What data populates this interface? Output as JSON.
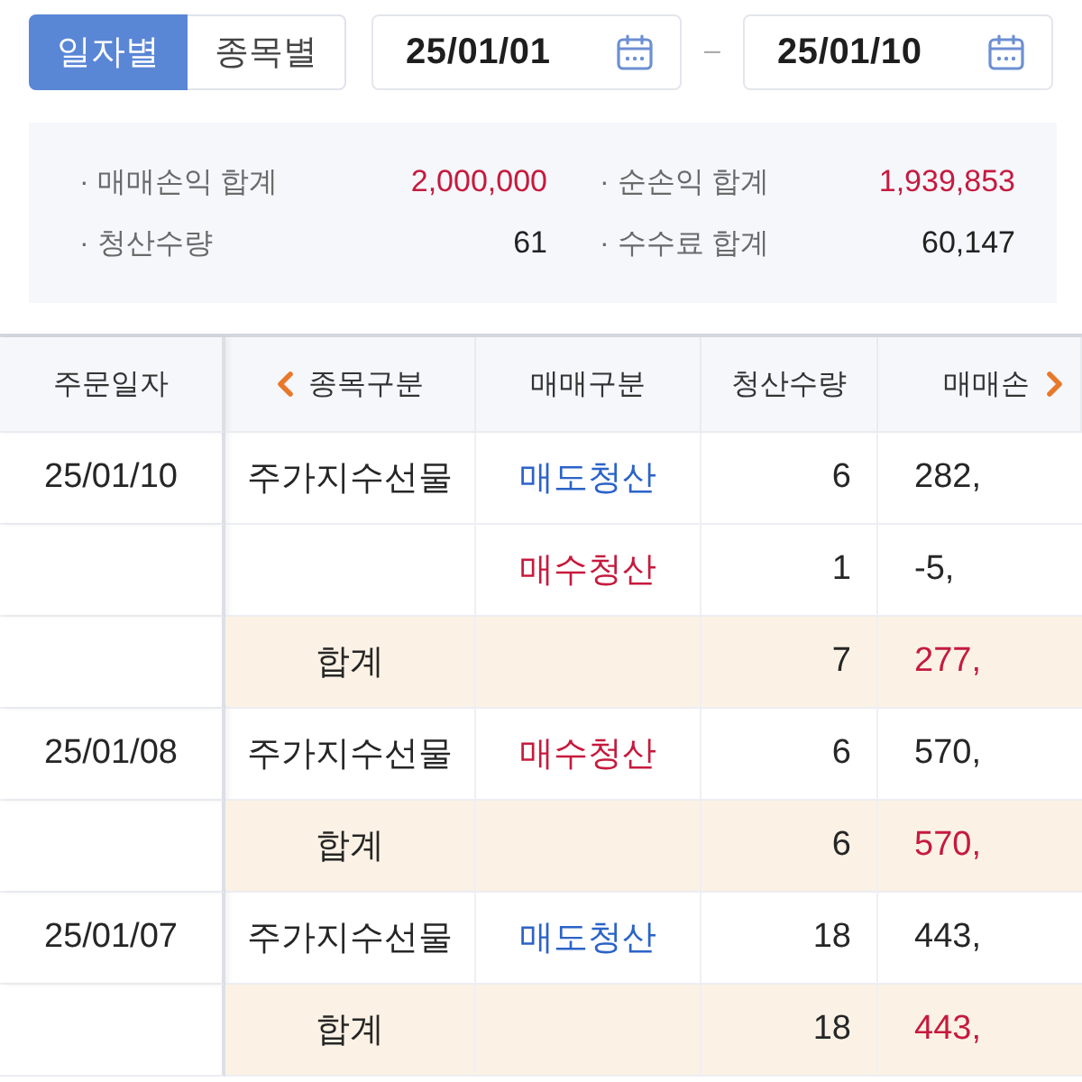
{
  "view_toggle": [
    {
      "label": "일자별",
      "selected": true
    },
    {
      "label": "종목별",
      "selected": false
    }
  ],
  "date_range": {
    "start": "25/01/01",
    "separator": "–",
    "end": "25/01/10"
  },
  "summary": [
    {
      "label": "· 매매손익 합계",
      "value": "2,000,000",
      "kind": "gain"
    },
    {
      "label": "· 순손익 합계",
      "value": "1,939,853",
      "kind": "gain"
    },
    {
      "label": "· 청산수량",
      "value": "61",
      "kind": "plain"
    },
    {
      "label": "· 수수료 합계",
      "value": "60,147",
      "kind": "plain"
    }
  ],
  "table": {
    "scroll_left": true,
    "scroll_right": true,
    "columns": [
      {
        "label": "주문일자"
      },
      {
        "label": "종목구분"
      },
      {
        "label": "매매구분"
      },
      {
        "label": "청산수량"
      },
      {
        "label": "매매손"
      }
    ],
    "rows": [
      {
        "kind": "trade",
        "date": "25/01/10",
        "product": "주가지수선물",
        "side": {
          "label": "매도청산",
          "kind": "sell"
        },
        "quantity": "6",
        "profit": "282,"
      },
      {
        "kind": "trade",
        "side": {
          "label": "매수청산",
          "kind": "buy"
        },
        "quantity": "1",
        "profit": "-5,"
      },
      {
        "kind": "subtotal",
        "label": "합계",
        "quantity": "7",
        "profit": "277,"
      },
      {
        "kind": "trade",
        "date": "25/01/08",
        "product": "주가지수선물",
        "side": {
          "label": "매수청산",
          "kind": "buy"
        },
        "quantity": "6",
        "profit": "570,"
      },
      {
        "kind": "subtotal",
        "label": "합계",
        "quantity": "6",
        "profit": "570,"
      },
      {
        "kind": "trade",
        "date": "25/01/07",
        "product": "주가지수선물",
        "side": {
          "label": "매도청산",
          "kind": "sell"
        },
        "quantity": "18",
        "profit": "443,"
      },
      {
        "kind": "subtotal",
        "label": "합계",
        "quantity": "18",
        "profit": "443,"
      }
    ]
  }
}
